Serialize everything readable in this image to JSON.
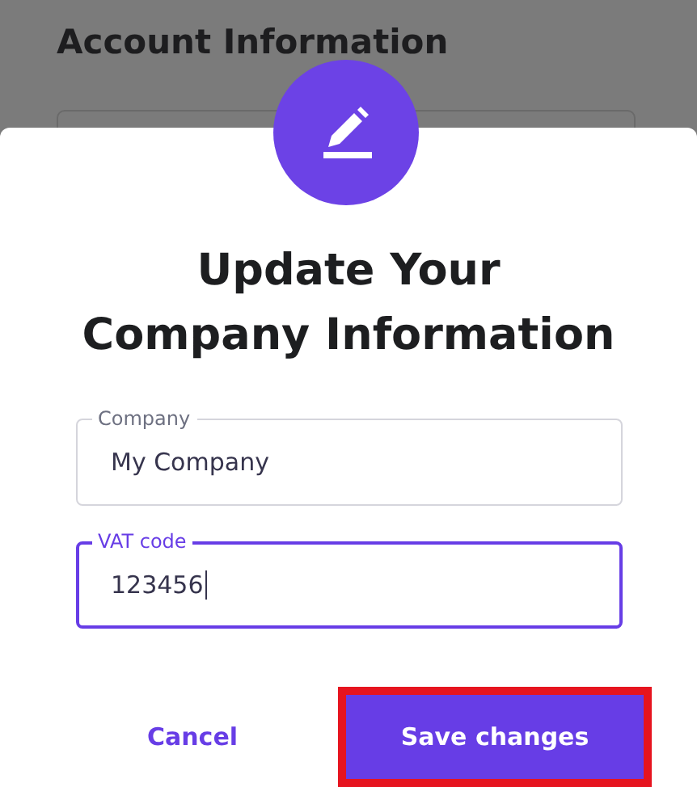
{
  "background": {
    "heading": "Account Information"
  },
  "dialog": {
    "title": "Update Your Company Information",
    "fields": [
      {
        "label": "Company",
        "value": "My Company",
        "focused": false
      },
      {
        "label": "VAT code",
        "value": "123456",
        "focused": true
      }
    ],
    "buttons": [
      {
        "label": "Cancel",
        "kind": "text",
        "highlighted": false
      },
      {
        "label": "Save changes",
        "kind": "primary",
        "highlighted": true
      }
    ]
  }
}
